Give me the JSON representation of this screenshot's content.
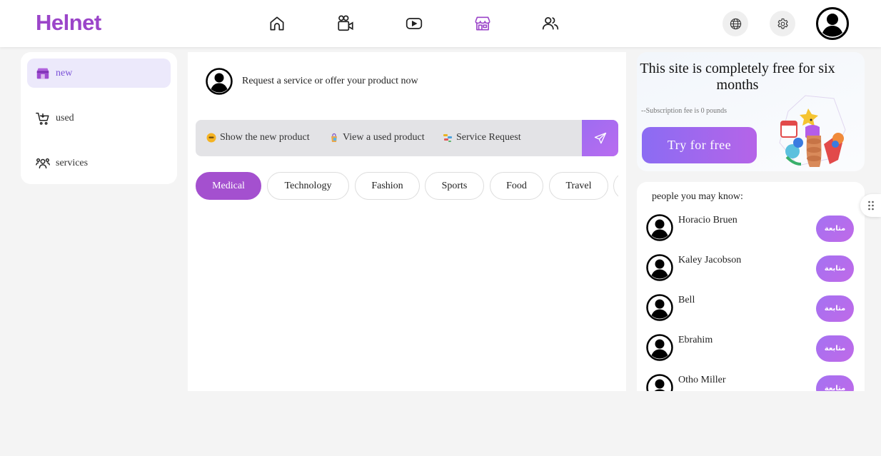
{
  "app": {
    "logo": "Helnet"
  },
  "colors": {
    "brand": "#9b45c9",
    "accent": "#9d6cf1",
    "active_nav": "#9b45c9"
  },
  "header": {
    "nav": [
      {
        "name": "home-icon"
      },
      {
        "name": "video-call-icon"
      },
      {
        "name": "play-icon"
      },
      {
        "name": "store-icon",
        "active": true
      },
      {
        "name": "users-icon"
      }
    ],
    "actions": [
      {
        "name": "globe-icon"
      },
      {
        "name": "gear-icon"
      },
      {
        "name": "user-avatar-icon"
      }
    ]
  },
  "sidebar": {
    "items": [
      {
        "label": "new",
        "icon": "store-icon",
        "active": true
      },
      {
        "label": "used",
        "icon": "cart-icon"
      },
      {
        "label": "services",
        "icon": "group-icon"
      }
    ]
  },
  "feed": {
    "prompt": "Request a service or offer your product now",
    "actions": [
      {
        "label": "Show the new product",
        "icon": "emoji-icon"
      },
      {
        "label": "View a used product",
        "icon": "bag-icon"
      },
      {
        "label": "Service Request",
        "icon": "tool-icon"
      }
    ],
    "categories": [
      "Medical",
      "Technology",
      "Fashion",
      "Sports",
      "Food",
      "Travel",
      ""
    ]
  },
  "promo": {
    "title": "This site is completely free for six months",
    "subtitle": "--Subscription fee is 0 pounds",
    "button": "Try for free"
  },
  "people": {
    "title": "people you may know:",
    "follow_label": "متابعة",
    "list": [
      {
        "name": "Horacio Bruen"
      },
      {
        "name": "Kaley Jacobson"
      },
      {
        "name": "Bell"
      },
      {
        "name": "Ebrahim"
      },
      {
        "name": "Otho Miller"
      }
    ]
  }
}
